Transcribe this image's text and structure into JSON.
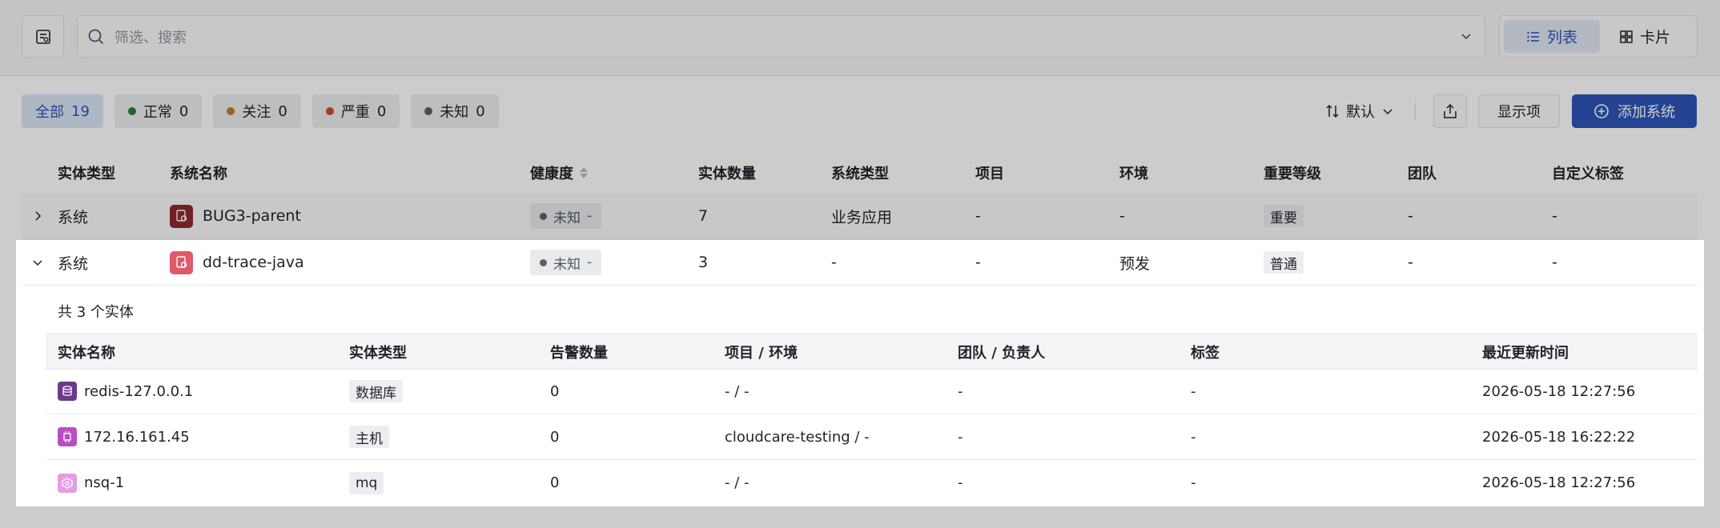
{
  "search": {
    "placeholder": "筛选、搜索"
  },
  "view_toggle": {
    "list_label": "列表",
    "card_label": "卡片"
  },
  "filters": [
    {
      "label": "全部",
      "count": "19",
      "color": ""
    },
    {
      "label": "正常",
      "count": "0",
      "color": "#2e7d32"
    },
    {
      "label": "关注",
      "count": "0",
      "color": "#c97a22"
    },
    {
      "label": "严重",
      "count": "0",
      "color": "#d4482b"
    },
    {
      "label": "未知",
      "count": "0",
      "color": "#5c6168"
    }
  ],
  "toolbar": {
    "sort_label": "默认",
    "columns_label": "显示项",
    "add_label": "添加系统"
  },
  "table": {
    "headers": [
      "实体类型",
      "系统名称",
      "健康度",
      "实体数量",
      "系统类型",
      "项目",
      "环境",
      "重要等级",
      "团队",
      "自定义标签"
    ],
    "rows": [
      {
        "type": "系统",
        "name": "BUG3-parent",
        "health": "未知",
        "health_extra": "-",
        "count": "7",
        "sys_type": "业务应用",
        "project": "-",
        "env": "-",
        "level": "重要",
        "team": "-",
        "tags": "-"
      },
      {
        "type": "系统",
        "name": "dd-trace-java",
        "health": "未知",
        "health_extra": "-",
        "count": "3",
        "sys_type": "-",
        "project": "-",
        "env": "预发",
        "level": "普通",
        "team": "-",
        "tags": "-"
      }
    ]
  },
  "expanded": {
    "summary": "共 3 个实体",
    "headers": [
      "实体名称",
      "实体类型",
      "告警数量",
      "项目 / 环境",
      "团队 / 负责人",
      "标签",
      "最近更新时间"
    ],
    "rows": [
      {
        "name": "redis-127.0.0.1",
        "type": "数据库",
        "alerts": "0",
        "project_env": "- / -",
        "team_owner": "-",
        "tags": "-",
        "updated": "2026-05-18 12:27:56"
      },
      {
        "name": "172.16.161.45",
        "type": "主机",
        "alerts": "0",
        "project_env": "cloudcare-testing / -",
        "team_owner": "-",
        "tags": "-",
        "updated": "2026-05-18 16:22:22"
      },
      {
        "name": "nsq-1",
        "type": "mq",
        "alerts": "0",
        "project_env": "- / -",
        "team_owner": "-",
        "tags": "-",
        "updated": "2026-05-18 12:27:56"
      }
    ]
  },
  "icons": {
    "sidebar_toggle": "panel-icon",
    "search": "search-icon",
    "list": "list-icon",
    "card": "grid-icon",
    "sort": "sort-icon",
    "export": "export-icon",
    "add": "plus-circle-icon",
    "expand": "chevron-right-icon",
    "collapse": "chevron-down-icon"
  },
  "colors": {
    "primary": "#2d56b8",
    "system_icon_1": "#8c2b2b",
    "system_icon_2": "#e05a6a",
    "db_icon": "#6b3a8f",
    "host_icon": "#b84ec0",
    "mq_icon": "#e59be6"
  }
}
